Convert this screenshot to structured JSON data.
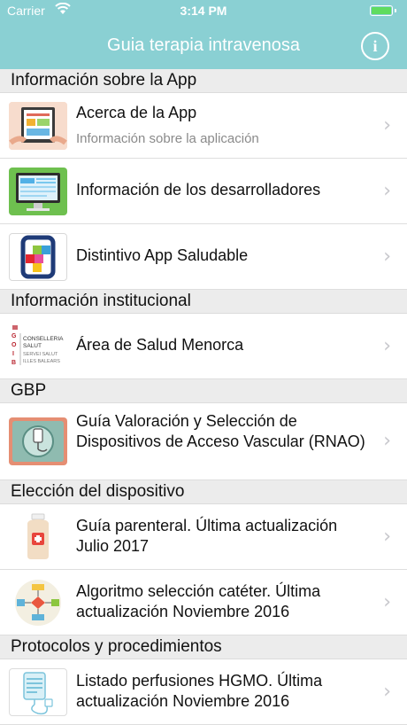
{
  "status_bar": {
    "carrier": "Carrier",
    "time": "3:14 PM"
  },
  "nav": {
    "title": "Guia terapia intravenosa",
    "info_glyph": "i"
  },
  "sections": [
    {
      "title": "Información sobre la App",
      "rows": [
        {
          "title": "Acerca de la App",
          "subtitle": "Información sobre la aplicación",
          "icon": "app-screen-thumbnail"
        },
        {
          "title": "Información de los desarrolladores",
          "icon": "monitor-thumbnail"
        },
        {
          "title": "Distintivo App Saludable",
          "icon": "app-saludable-logo"
        }
      ]
    },
    {
      "title": "Información institucional",
      "rows": [
        {
          "title": "Área de Salud Menorca",
          "icon": "goib-conselleria-logo",
          "logo_text": [
            "CONSELLERIA",
            "SALUT",
            "SERVEI SALUT",
            "ILLES BALEARS"
          ]
        }
      ]
    },
    {
      "title": "GBP",
      "rows": [
        {
          "title": "Guía Valoración y Selección de Dispositivos de Acceso Vascular (RNAO)",
          "icon": "iv-device-thumbnail"
        }
      ]
    },
    {
      "title": "Elección del dispositivo",
      "rows": [
        {
          "title": "Guía parenteral. Última actualización Julio 2017",
          "icon": "parenteral-bottle-icon"
        },
        {
          "title": "Algoritmo selección catéter. Última actualización Noviembre 2016",
          "icon": "flowchart-icon"
        }
      ]
    },
    {
      "title": "Protocolos y procedimientos",
      "rows": [
        {
          "title": "Listado perfusiones HGMO. Última actualización Noviembre 2016",
          "icon": "iv-bag-icon"
        }
      ]
    }
  ],
  "colors": {
    "header": "#8ad0d3",
    "section_bg": "#ececec",
    "chevron": "#c7c7cc"
  }
}
